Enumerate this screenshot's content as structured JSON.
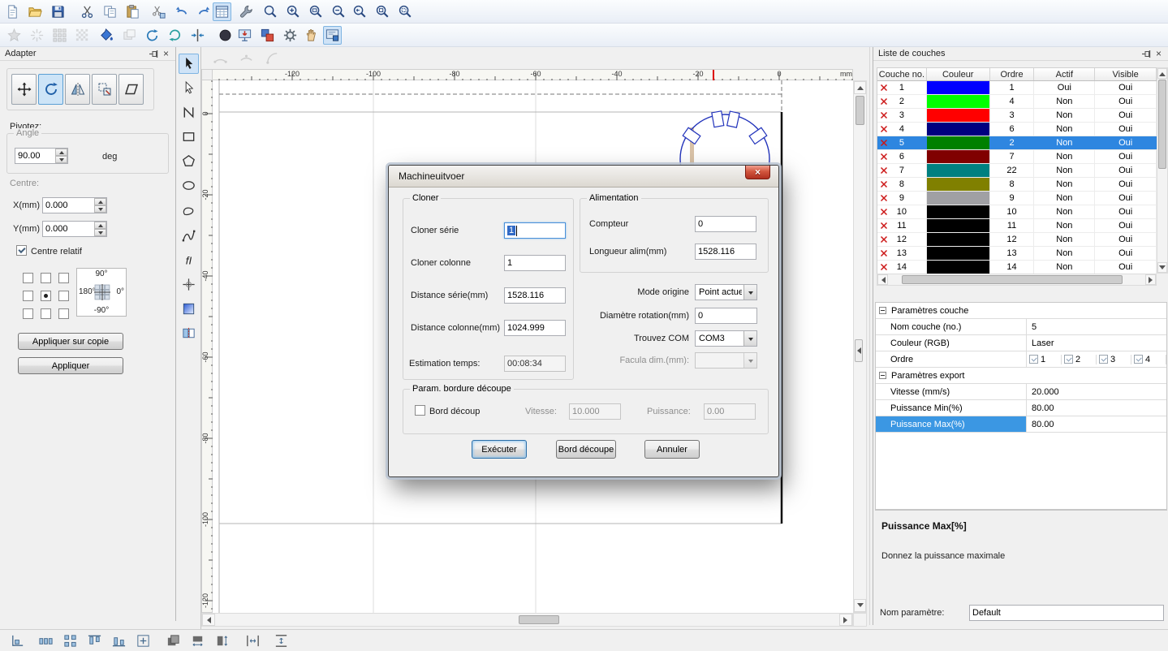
{
  "app": {
    "bg": "#f0f0f0",
    "selection_color": "#2e86e0",
    "shape_stroke": "#2233bb",
    "ruler_marker": "#dd0000"
  },
  "toolbars": {
    "row1": [
      {
        "name": "new-file"
      },
      {
        "name": "open-file"
      },
      {
        "name": "save-file"
      },
      {
        "name": "cut"
      },
      {
        "name": "copy"
      },
      {
        "name": "paste"
      },
      {
        "name": "cut-object"
      },
      {
        "name": "undo"
      },
      {
        "name": "redo"
      },
      {
        "name": "data-grid",
        "pressed": true
      },
      {
        "name": "wrench-tool"
      },
      {
        "name": "zoom"
      },
      {
        "name": "zoom-in"
      },
      {
        "name": "zoom-window"
      },
      {
        "name": "zoom-out"
      },
      {
        "name": "zoom-previous"
      },
      {
        "name": "zoom-page"
      },
      {
        "name": "zoom-selection"
      }
    ],
    "row2": [
      {
        "name": "weld",
        "disabled": true
      },
      {
        "name": "explode",
        "disabled": true
      },
      {
        "name": "array-copy",
        "disabled": true
      },
      {
        "name": "dither",
        "disabled": true
      },
      {
        "name": "fill-color"
      },
      {
        "name": "offset-path",
        "disabled": true
      },
      {
        "name": "rotate-copy"
      },
      {
        "name": "mirror-copy"
      },
      {
        "name": "node-align"
      },
      {
        "name": "origin-dot"
      },
      {
        "name": "download-to-machine"
      },
      {
        "name": "output-layers"
      },
      {
        "name": "machine-settings"
      },
      {
        "name": "pan-hand"
      },
      {
        "name": "simulate-output",
        "pressed": true
      }
    ],
    "palette": [
      {
        "name": "select-tool",
        "pressed": true
      },
      {
        "name": "node-edit-tool"
      },
      {
        "name": "polyline-tool"
      },
      {
        "name": "rectangle-tool"
      },
      {
        "name": "polygon-tool"
      },
      {
        "name": "ellipse-tool"
      },
      {
        "name": "freehand-tool"
      },
      {
        "name": "spline-tool"
      },
      {
        "name": "text-tool"
      },
      {
        "name": "snap-cross-tool"
      },
      {
        "name": "gradient-tool"
      },
      {
        "name": "mirror-page-tool"
      }
    ],
    "arcs": [
      {
        "name": "arc-tool-1",
        "disabled": true
      },
      {
        "name": "arc-tool-2",
        "disabled": true
      },
      {
        "name": "arc-tool-3",
        "disabled": true
      }
    ],
    "bottom": [
      {
        "name": "align-origin"
      },
      {
        "name": "distribute-horizontal"
      },
      {
        "name": "distribute-grid"
      },
      {
        "name": "align-top"
      },
      {
        "name": "align-bottom"
      },
      {
        "name": "center-to-page"
      },
      {
        "name": "same-size"
      },
      {
        "name": "same-width"
      },
      {
        "name": "same-height"
      },
      {
        "name": "equal-space-horizontal"
      },
      {
        "name": "equal-space-vertical"
      }
    ]
  },
  "adapter": {
    "title": "Adapter",
    "pivot_label": "Pivotez:",
    "angle_label": "Angle",
    "angle_value": "90.00",
    "angle_unit": "deg",
    "centre_label": "Centre:",
    "x_label": "X(mm)",
    "x_value": "0.000",
    "y_label": "Y(mm)",
    "y_value": "0.000",
    "relative_label": "Centre relatif",
    "dial": {
      "top": "90°",
      "left": "180°",
      "right": "0°",
      "bottom": "-90°"
    },
    "apply_copy_label": "Appliquer sur copie",
    "apply_label": "Appliquer"
  },
  "rulers": {
    "h_labels": [
      "-120",
      "-100",
      "-80",
      "-60",
      "-40",
      "-20",
      "0"
    ],
    "v_labels": [
      "0",
      "-20",
      "-40",
      "-60",
      "-80",
      "-100",
      "-120"
    ],
    "unit": "mm"
  },
  "dialog": {
    "title": "Machineuitvoer",
    "cloner": {
      "group": "Cloner",
      "serie_label": "Cloner série",
      "serie_value": "1",
      "colonne_label": "Cloner colonne",
      "colonne_value": "1",
      "dist_serie_label": "Distance série(mm)",
      "dist_serie_value": "1528.116",
      "dist_colonne_label": "Distance colonne(mm)",
      "dist_colonne_value": "1024.999",
      "estimation_label": "Estimation temps:",
      "estimation_value": "00:08:34"
    },
    "alimentation": {
      "group": "Alimentation",
      "compteur_label": "Compteur",
      "compteur_value": "0",
      "longueur_label": "Longueur alim(mm)",
      "longueur_value": "1528.116"
    },
    "origin": {
      "mode_label": "Mode origine",
      "mode_value": "Point actue",
      "diametre_label": "Diamètre rotation(mm)",
      "diametre_value": "0",
      "com_label": "Trouvez COM",
      "com_value": "COM3",
      "facula_label": "Facula dim.(mm):",
      "facula_value": ""
    },
    "bordure": {
      "group": "Param. bordure découpe",
      "check_label": "Bord découp",
      "vitesse_label": "Vitesse:",
      "vitesse_value": "10.000",
      "puissance_label": "Puissance:",
      "puissance_value": "0.00"
    },
    "execute_label": "Exécuter",
    "border_label": "Bord découpe",
    "cancel_label": "Annuler"
  },
  "layers": {
    "title": "Liste de couches",
    "columns": [
      "Couche no.",
      "Couleur",
      "Ordre",
      "Actif",
      "Visible"
    ],
    "rows": [
      {
        "no": "1",
        "color": "#0000FF",
        "ordre": "1",
        "actif": "Oui",
        "visible": "Oui",
        "selected": false
      },
      {
        "no": "2",
        "color": "#00FF00",
        "ordre": "4",
        "actif": "Non",
        "visible": "Oui",
        "selected": false
      },
      {
        "no": "3",
        "color": "#FF0000",
        "ordre": "3",
        "actif": "Non",
        "visible": "Oui",
        "selected": false
      },
      {
        "no": "4",
        "color": "#000080",
        "ordre": "6",
        "actif": "Non",
        "visible": "Oui",
        "selected": false
      },
      {
        "no": "5",
        "color": "#008000",
        "ordre": "2",
        "actif": "Non",
        "visible": "Oui",
        "selected": true
      },
      {
        "no": "6",
        "color": "#800000",
        "ordre": "7",
        "actif": "Non",
        "visible": "Oui",
        "selected": false
      },
      {
        "no": "7",
        "color": "#008080",
        "ordre": "22",
        "actif": "Non",
        "visible": "Oui",
        "selected": false
      },
      {
        "no": "8",
        "color": "#808000",
        "ordre": "8",
        "actif": "Non",
        "visible": "Oui",
        "selected": false
      },
      {
        "no": "9",
        "color": "#A0A0A4",
        "ordre": "9",
        "actif": "Non",
        "visible": "Oui",
        "selected": false
      },
      {
        "no": "10",
        "color": "#000000",
        "ordre": "10",
        "actif": "Non",
        "visible": "Oui",
        "selected": false
      },
      {
        "no": "11",
        "color": "#000000",
        "ordre": "11",
        "actif": "Non",
        "visible": "Oui",
        "selected": false
      },
      {
        "no": "12",
        "color": "#000000",
        "ordre": "12",
        "actif": "Non",
        "visible": "Oui",
        "selected": false
      },
      {
        "no": "13",
        "color": "#000000",
        "ordre": "13",
        "actif": "Non",
        "visible": "Oui",
        "selected": false
      },
      {
        "no": "14",
        "color": "#000000",
        "ordre": "14",
        "actif": "Non",
        "visible": "Oui",
        "selected": false
      }
    ],
    "properties": [
      {
        "type": "group",
        "label": "Paramètres couche"
      },
      {
        "type": "kv",
        "label": "Nom couche (no.)",
        "value": "5"
      },
      {
        "type": "kv",
        "label": "Couleur (RGB)",
        "value": "Laser"
      },
      {
        "type": "ordre",
        "label": "Ordre",
        "options": [
          "1",
          "2",
          "3",
          "4"
        ]
      },
      {
        "type": "group",
        "label": "Paramètres export"
      },
      {
        "type": "kv",
        "label": "Vitesse (mm/s)",
        "value": "20.000"
      },
      {
        "type": "kv",
        "label": "Puissance Min(%)",
        "value": "80.00"
      },
      {
        "type": "kv",
        "label": "Puissance Max(%)",
        "value": "80.00",
        "selected": true
      }
    ],
    "description_title": "Puissance Max[%]",
    "description_text": "Donnez la puissance maximale",
    "param_label": "Nom paramètre:",
    "param_value": "Default"
  }
}
